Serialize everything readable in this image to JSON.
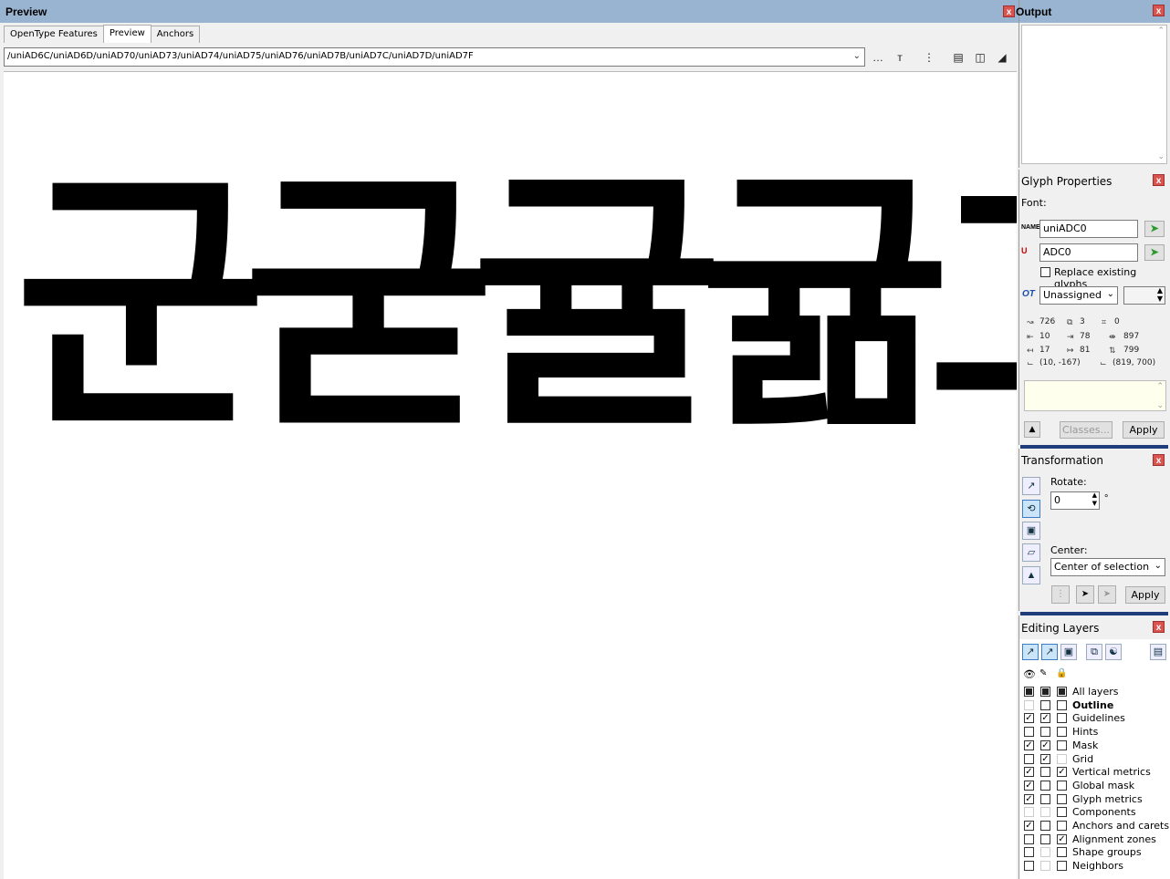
{
  "preview": {
    "title": "Preview",
    "tabs": [
      "OpenType Features",
      "Preview",
      "Anchors"
    ],
    "active_tab": "Preview",
    "glyph_path": "/uniAD6C/uniAD6D/uniAD70/uniAD73/uniAD74/uniAD75/uniAD76/uniAD7B/uniAD7C/uniAD7D/uniAD7F",
    "preview_glyphs": [
      "군",
      "굳",
      "귤",
      "귦",
      "그"
    ]
  },
  "output": {
    "title": "Output"
  },
  "glyph_properties": {
    "title": "Glyph Properties",
    "font_label": "Font:",
    "name_value": "uniADC0",
    "unicode_value": "ADC0",
    "replace_label": "Replace existing glyphs",
    "ot_class": "Unassigned",
    "metrics": {
      "advance": "726",
      "contours": "3",
      "points": "0",
      "lsb": "10",
      "rsb": "78",
      "width": "897",
      "lsb2": "17",
      "rsb2": "81",
      "height": "799",
      "bbox_min": "(10, -167)",
      "bbox_max": "(819, 700)"
    },
    "classes_button": "Classes...",
    "apply_button": "Apply"
  },
  "transformation": {
    "title": "Transformation",
    "rotate_label": "Rotate:",
    "rotate_value": "0",
    "degree_symbol": "°",
    "center_label": "Center:",
    "center_value": "Center of selection",
    "apply_button": "Apply"
  },
  "editing_layers": {
    "title": "Editing Layers",
    "layers": [
      {
        "name": "All layers",
        "c1": "ind",
        "c2": "ind",
        "c3": "ind",
        "bold": false
      },
      {
        "name": "Outline",
        "c1": "none",
        "c2": "off",
        "c3": "off",
        "bold": true
      },
      {
        "name": "Guidelines",
        "c1": "on",
        "c2": "on",
        "c3": "off",
        "bold": false
      },
      {
        "name": "Hints",
        "c1": "off",
        "c2": "off",
        "c3": "off",
        "bold": false
      },
      {
        "name": "Mask",
        "c1": "on",
        "c2": "on",
        "c3": "off",
        "bold": false
      },
      {
        "name": "Grid",
        "c1": "off",
        "c2": "on",
        "c3": "none",
        "bold": false
      },
      {
        "name": "Vertical metrics",
        "c1": "on",
        "c2": "off",
        "c3": "on",
        "bold": false
      },
      {
        "name": "Global mask",
        "c1": "on",
        "c2": "off",
        "c3": "off",
        "bold": false
      },
      {
        "name": "Glyph metrics",
        "c1": "on",
        "c2": "off",
        "c3": "off",
        "bold": false
      },
      {
        "name": "Components",
        "c1": "none",
        "c2": "none",
        "c3": "off",
        "bold": false
      },
      {
        "name": "Anchors and carets",
        "c1": "on",
        "c2": "off",
        "c3": "off",
        "bold": false
      },
      {
        "name": "Alignment zones",
        "c1": "off",
        "c2": "off",
        "c3": "on",
        "bold": false
      },
      {
        "name": "Shape groups",
        "c1": "off",
        "c2": "none",
        "c3": "off",
        "bold": false
      },
      {
        "name": "Neighbors",
        "c1": "off",
        "c2": "none",
        "c3": "off",
        "bold": false
      }
    ]
  }
}
